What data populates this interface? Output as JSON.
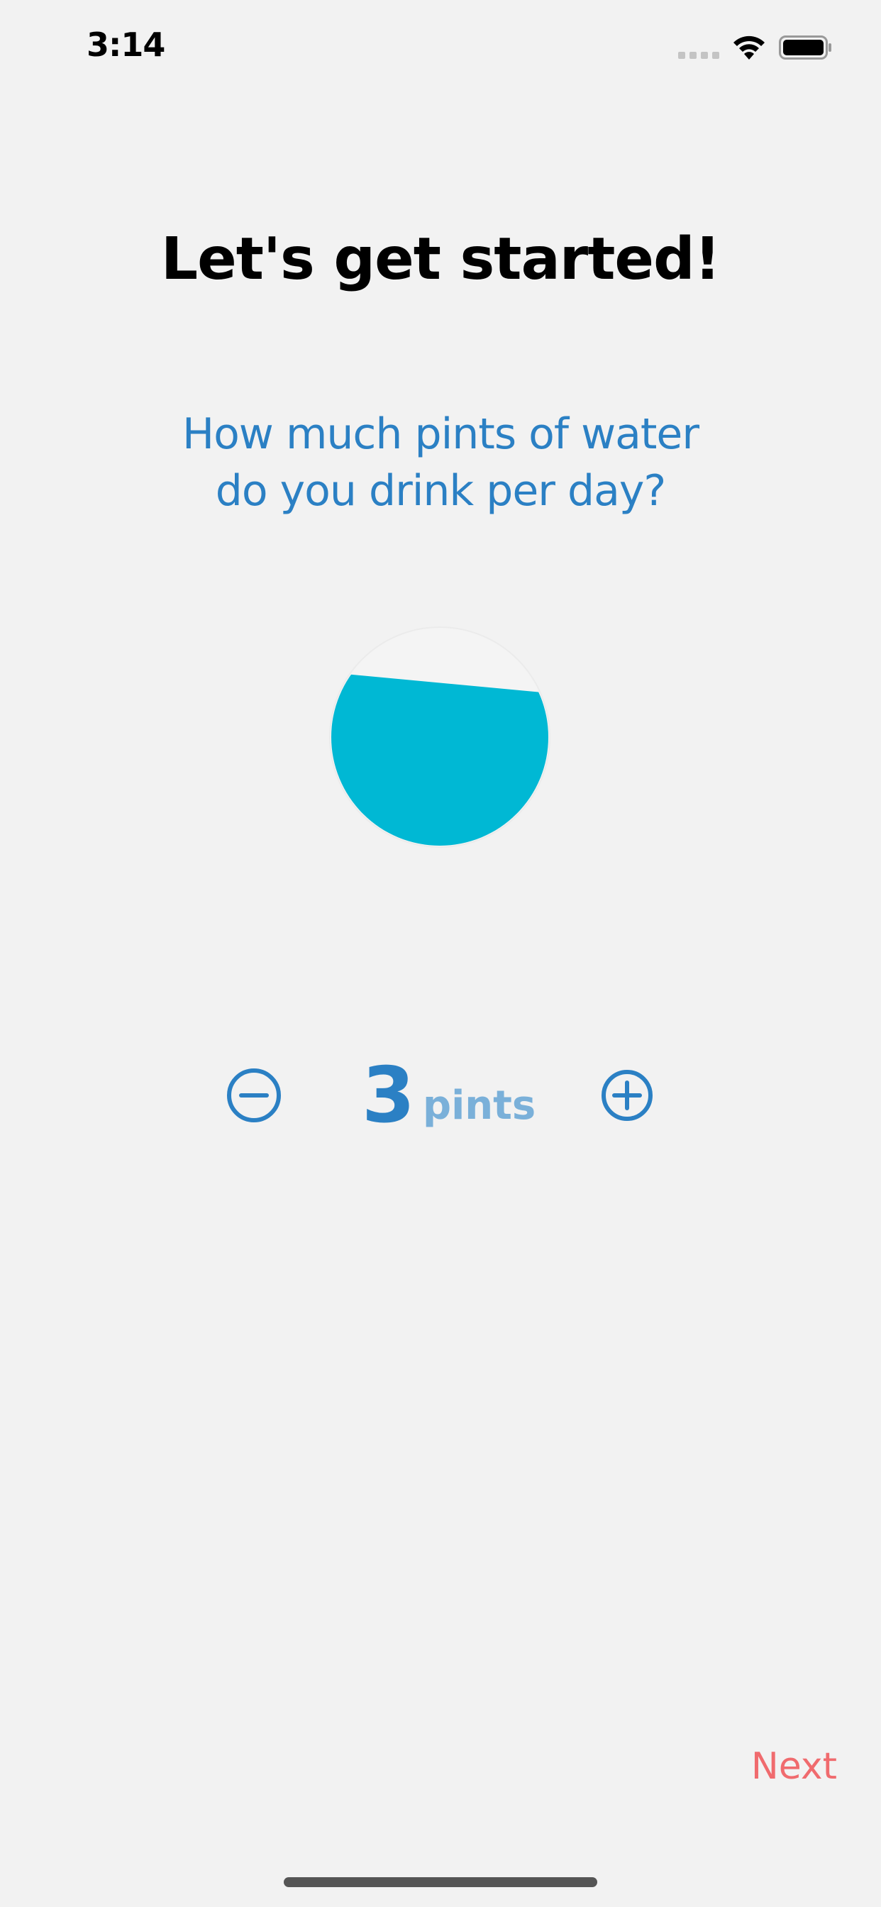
{
  "status_bar": {
    "time": "3:14",
    "icons": [
      "cellular-signal-icon",
      "wifi-icon",
      "battery-icon"
    ]
  },
  "onboarding": {
    "title": "Let's get started!",
    "question_line1": "How much pints of water",
    "question_line2": "do you drink per day?",
    "glass_icon": "water-glass-icon",
    "glass_fill_fraction": 0.75
  },
  "stepper": {
    "value": "3",
    "unit": "pints",
    "decrement_icon": "minus-circle-icon",
    "increment_icon": "plus-circle-icon"
  },
  "footer": {
    "next_label": "Next"
  },
  "colors": {
    "background": "#f2f2f2",
    "accent_blue": "#2b80c4",
    "unit_blue": "#7ab0d9",
    "water": "#00b8d4",
    "next_red": "#f06b6e"
  }
}
